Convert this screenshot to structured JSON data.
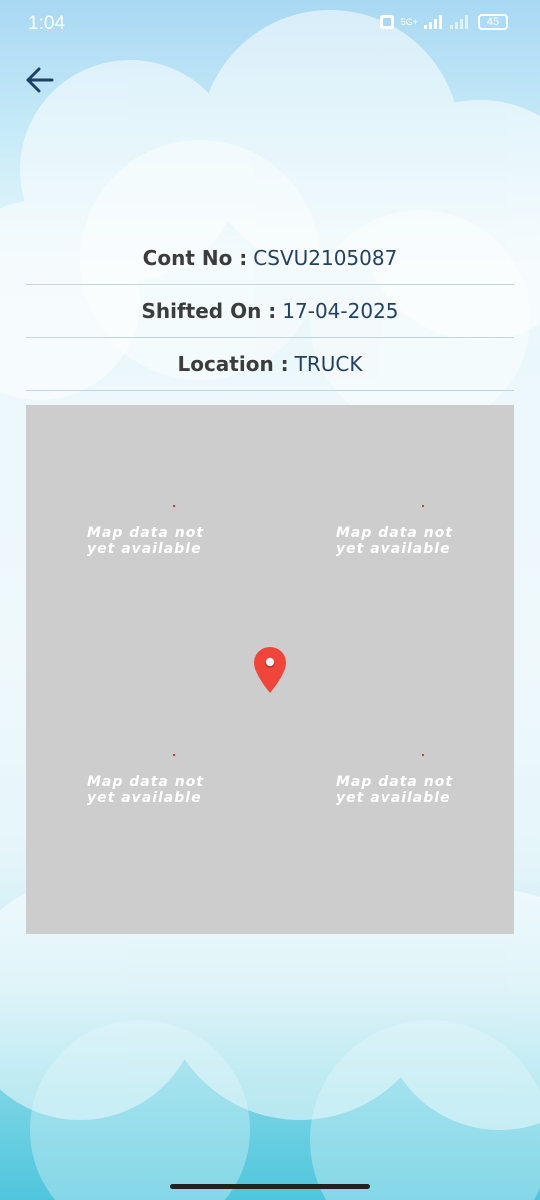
{
  "status_bar": {
    "time": "1:04",
    "network": "5G+",
    "battery": "45"
  },
  "details": {
    "cont_no_label": "Cont No :",
    "cont_no_value": "CSVU2105087",
    "shifted_on_label": "Shifted On :",
    "shifted_on_value": "17-04-2025",
    "location_label": "Location :",
    "location_value": "TRUCK"
  },
  "map": {
    "tile_text_line1": "Map data not",
    "tile_text_line2": "yet available",
    "pin_color": "#f0453a",
    "background": "#cdcdcd"
  },
  "colors": {
    "back_arrow": "#1f3f66",
    "value_text": "#24415f",
    "label_text": "#3c3c3c"
  }
}
